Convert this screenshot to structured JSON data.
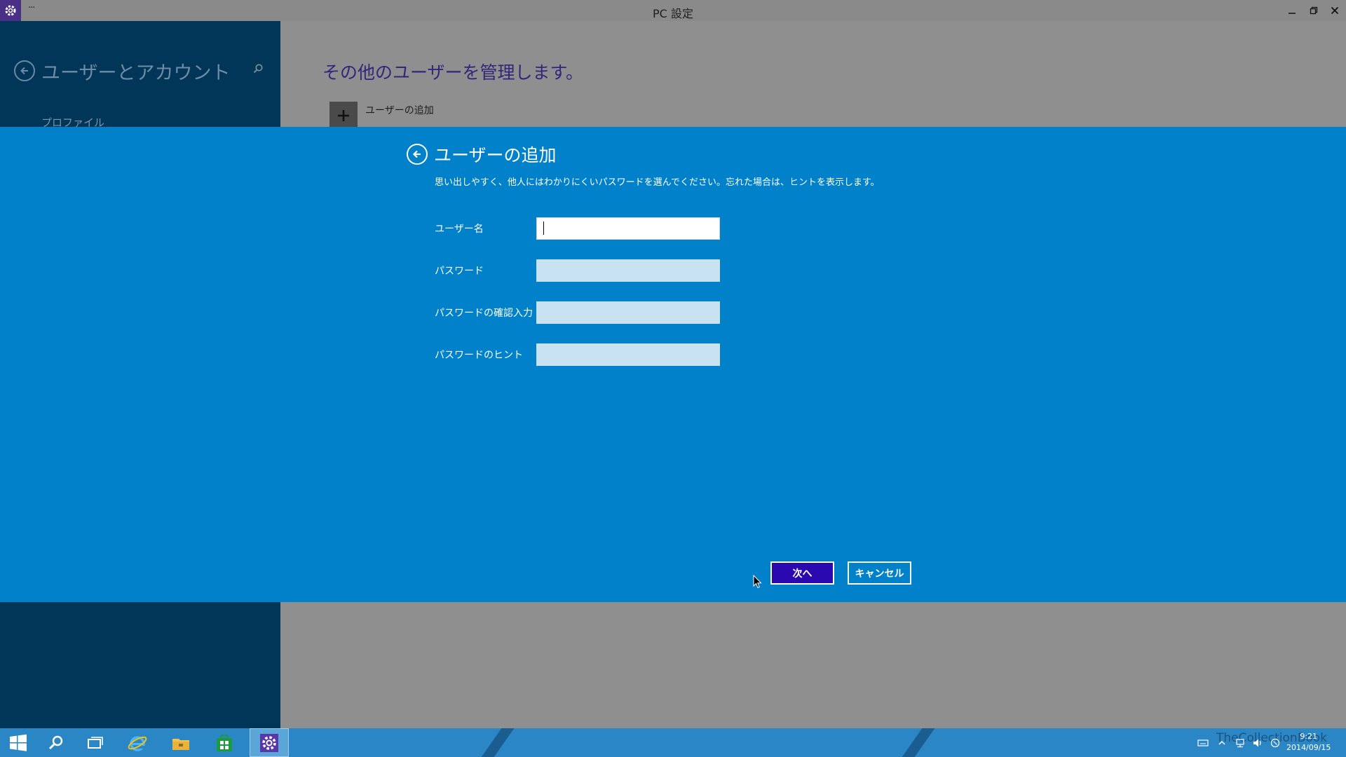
{
  "window": {
    "title": "PC 設定",
    "menu": "···",
    "app_icon": "gear-icon",
    "controls": {
      "minimize": "minimize-icon",
      "maximize": "restore-icon",
      "close": "close-icon"
    }
  },
  "sidebar": {
    "title": "ユーザーとアカウント",
    "items": [
      {
        "label": "プロファイル"
      }
    ]
  },
  "main": {
    "heading": "その他のユーザーを管理します。",
    "add_user_label": "ユーザーの追加"
  },
  "dialog": {
    "title": "ユーザーの追加",
    "subtitle": "思い出しやすく、他人にはわかりにくいパスワードを選んでください。忘れた場合は、ヒントを表示します。",
    "fields": [
      {
        "label": "ユーザー名",
        "value": ""
      },
      {
        "label": "パスワード",
        "value": ""
      },
      {
        "label": "パスワードの確認入力",
        "value": ""
      },
      {
        "label": "パスワードのヒント",
        "value": ""
      }
    ],
    "next_label": "次へ",
    "cancel_label": "キャンセル"
  },
  "taskbar": {
    "items": [
      "start",
      "search",
      "task-view",
      "internet-explorer",
      "file-explorer",
      "store",
      "pc-settings"
    ],
    "watermark": "TheCollectionBook",
    "clock": {
      "time": "9:21",
      "date": "2014/09/15"
    }
  },
  "colors": {
    "dialog_bg": "#0081c9",
    "sidebar_bg": "#013658",
    "accent_button": "#2a0ab0",
    "taskbar": "#2b86c5"
  }
}
